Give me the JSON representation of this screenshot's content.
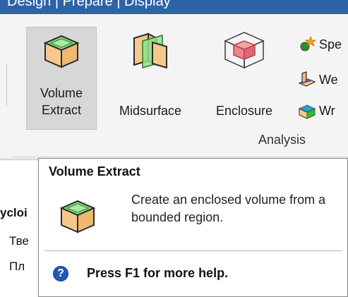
{
  "window": {
    "title": "Design | Prepare | Display"
  },
  "ribbon": {
    "buttons": [
      {
        "line1": "Volume",
        "line2": "Extract",
        "icon": "volume-extract-icon"
      },
      {
        "line1": "Midsurface",
        "icon": "midsurface-icon"
      },
      {
        "line1": "Enclosure",
        "icon": "enclosure-icon"
      }
    ],
    "small_buttons": [
      {
        "label": "Spe",
        "icon": "spot-weld-icon"
      },
      {
        "label": "We",
        "icon": "weld-icon"
      },
      {
        "label": "Wr",
        "icon": "wrap-icon"
      }
    ],
    "group_label": "Analysis"
  },
  "background": {
    "lines": [
      "ycloi",
      "Тве",
      "Пл"
    ]
  },
  "tooltip": {
    "title": "Volume Extract",
    "description": "Create an enclosed volume from a bounded region.",
    "help_icon_glyph": "?",
    "help_text": "Press F1 for more help."
  },
  "colors": {
    "titlebar": "#2e63a8",
    "active_button": "#d7d7d7",
    "box_green": "#7ed87a",
    "box_tan": "#f5c98c",
    "help_blue": "#2456b8"
  }
}
